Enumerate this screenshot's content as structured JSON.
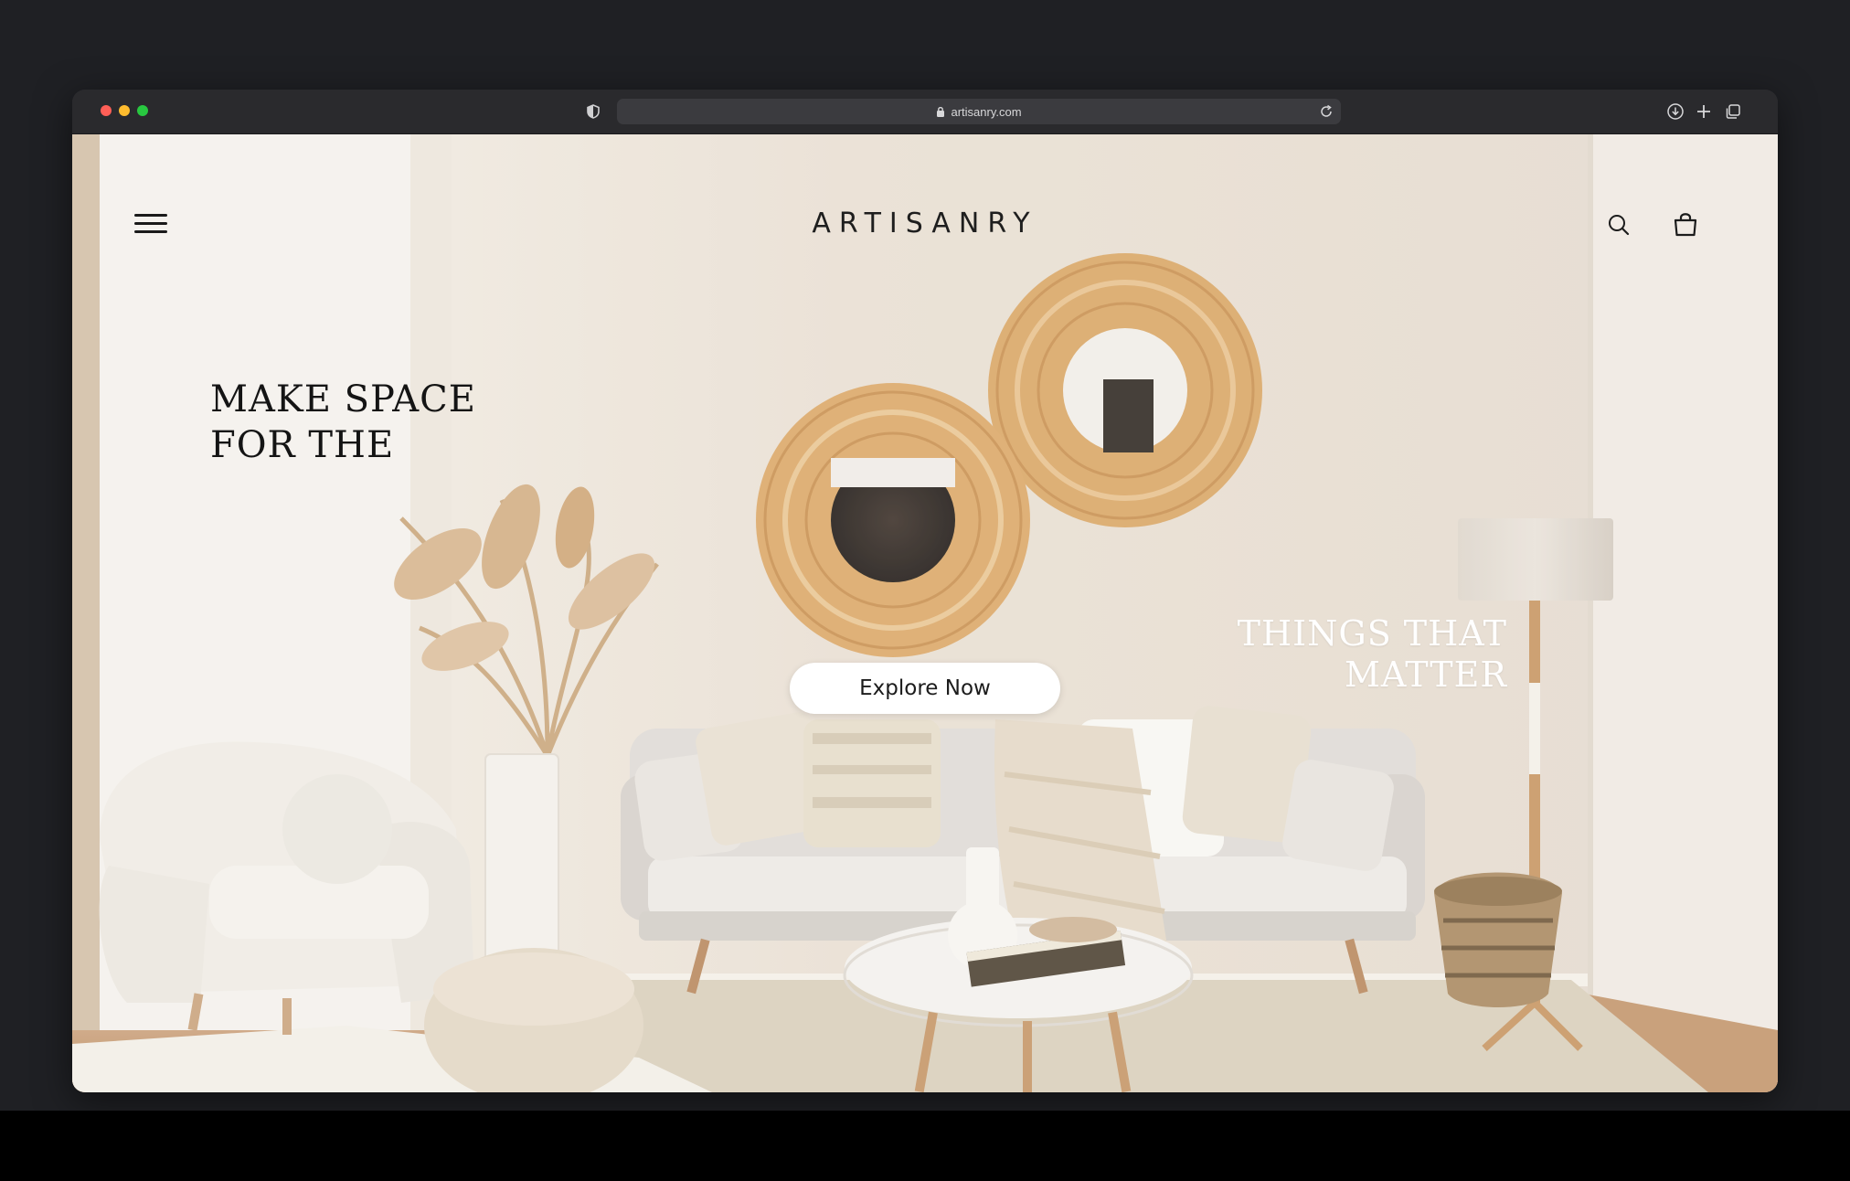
{
  "browser": {
    "url": "artisanry.com"
  },
  "site": {
    "logo": "ARTISANRY",
    "headline_left": [
      "MAKE SPACE",
      "FOR THE"
    ],
    "headline_right": [
      "THINGS THAT",
      "MATTER"
    ],
    "cta_label": "Explore Now"
  },
  "icons": {
    "menu": "hamburger-icon",
    "search": "search-icon",
    "cart": "shopping-bag-icon",
    "downloads": "download-icon",
    "new_tab": "plus-icon",
    "tabs": "tabs-overview-icon"
  },
  "colors": {
    "window_bg": "#1f2024",
    "toolbar": "#2a2a2d",
    "wall": "#e7ddd0",
    "accent_rattan": "#d6a25f"
  }
}
